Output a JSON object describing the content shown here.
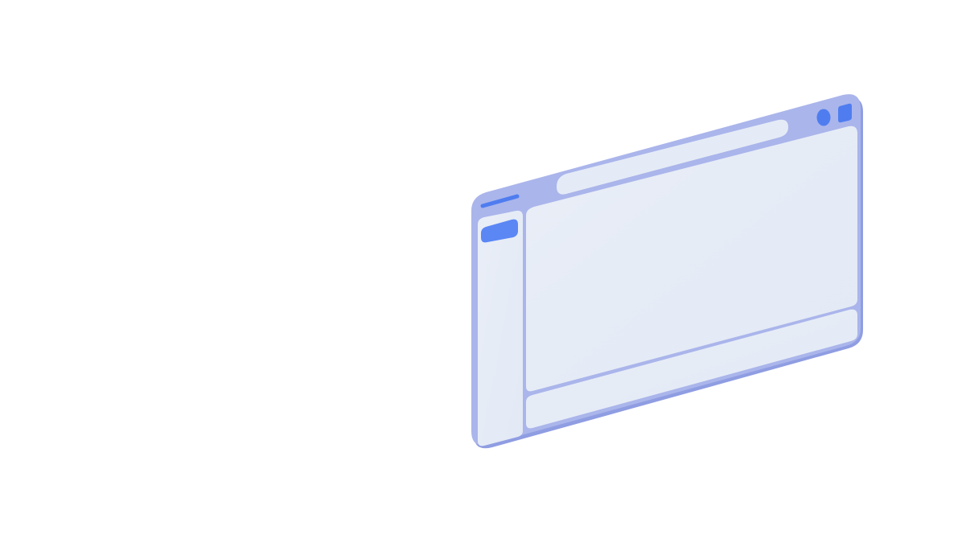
{
  "illustration": {
    "subject": "browser-window-mockup",
    "colors": {
      "background": "#ffffff",
      "frame": "#a9b4ea",
      "frame_edge": "#8f9de2",
      "panel": "#e6ecf6",
      "accent": "#4f7df0",
      "accent_light": "#5b87f5"
    },
    "icons": {
      "window_controls": [
        "circle-control-icon",
        "square-control-icon"
      ],
      "logo": "logo-bar-icon",
      "nav": "active-nav-item-icon"
    }
  }
}
